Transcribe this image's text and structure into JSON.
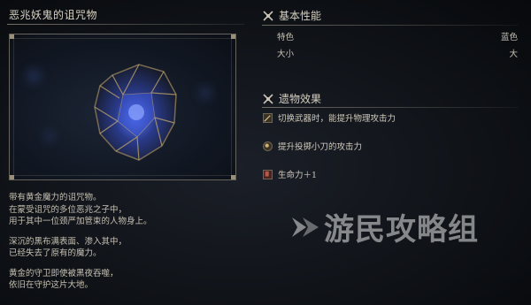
{
  "relic": {
    "name": "恶兆妖鬼的诅咒物",
    "description": [
      [
        "带有黄金魔力的诅咒物。",
        "在蒙受诅咒的多位恶兆之子中，",
        "用于其中一位颈严加管束的人物身上。"
      ],
      [
        "深沉的黑布满表面、渗入其中，",
        "已经失去了原有的魔力。"
      ],
      [
        "黄金的守卫即使被黑夜吞噬，",
        "依旧在守护这片大地。"
      ]
    ]
  },
  "basic": {
    "header": "基本性能",
    "rows": [
      {
        "label": "特色",
        "value": "蓝色"
      },
      {
        "label": "大小",
        "value": "大"
      }
    ]
  },
  "effects": {
    "header": "遗物效果",
    "items": [
      {
        "text": "切换武器时，能提升物理攻击力",
        "icon": "sword-icon"
      },
      {
        "text": "提升投掷小刀的攻击力",
        "icon": "dagger-icon"
      },
      {
        "text": "生命力＋1",
        "icon": "vigor-icon"
      }
    ]
  },
  "watermark": "游民攻略组",
  "colors": {
    "accent": "#4d6cff",
    "gold": "#b8a06a",
    "text": "#c9c3b5"
  }
}
